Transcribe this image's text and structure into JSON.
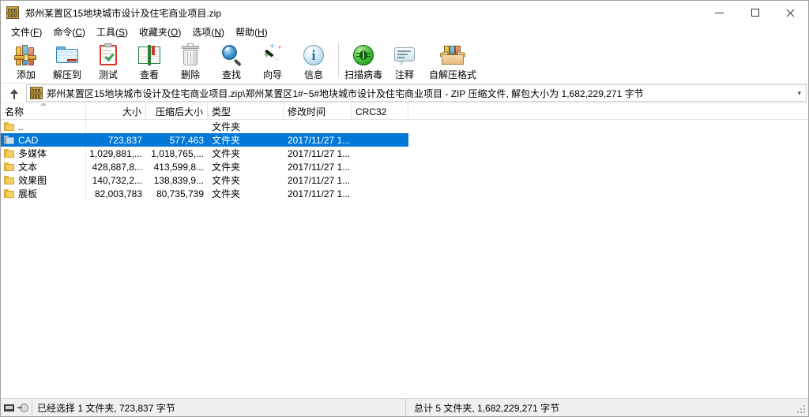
{
  "window": {
    "title": "郑州某置区15地块城市设计及住宅商业项目.zip",
    "icon": "winrar-archive-icon",
    "minimize_label": "最小化",
    "maximize_label": "最大化",
    "close_label": "关闭"
  },
  "menu": {
    "items": [
      {
        "label": "文件(F)",
        "text": "文件(",
        "accel": "F",
        "tail": ")"
      },
      {
        "label": "命令(C)",
        "text": "命令(",
        "accel": "C",
        "tail": ")"
      },
      {
        "label": "工具(S)",
        "text": "工具(",
        "accel": "S",
        "tail": ")"
      },
      {
        "label": "收藏夹(O)",
        "text": "收藏夹(",
        "accel": "O",
        "tail": ")"
      },
      {
        "label": "选项(N)",
        "text": "选项(",
        "accel": "N",
        "tail": ")"
      },
      {
        "label": "帮助(H)",
        "text": "帮助(",
        "accel": "H",
        "tail": ")"
      }
    ]
  },
  "toolbar": {
    "buttons": [
      {
        "label": "添加",
        "icon": "add-archive-icon"
      },
      {
        "label": "解压到",
        "icon": "extract-to-folder-icon"
      },
      {
        "label": "测试",
        "icon": "test-clipboard-icon"
      },
      {
        "label": "查看",
        "icon": "view-book-icon"
      },
      {
        "label": "删除",
        "icon": "delete-trash-icon"
      },
      {
        "label": "查找",
        "icon": "find-magnifier-icon"
      },
      {
        "label": "向导",
        "icon": "wizard-wand-icon"
      },
      {
        "label": "信息",
        "icon": "info-circle-icon"
      },
      {
        "label": "扫描病毒",
        "icon": "virus-scan-icon"
      },
      {
        "label": "注释",
        "icon": "comment-bubble-icon"
      },
      {
        "label": "自解压格式",
        "icon": "sfx-box-icon"
      }
    ]
  },
  "address": {
    "up_button_label": "上一层",
    "icon": "winrar-archive-icon",
    "path": "郑州某置区15地块城市设计及住宅商业项目.zip\\郑州某置区1#~5#地块城市设计及住宅商业项目 - ZIP 压缩文件, 解包大小为 1,682,229,271 字节",
    "dropdown_icon": "chevron-down-icon"
  },
  "list": {
    "columns": [
      {
        "key": "name",
        "label": "名称",
        "align": "left",
        "sorted": true
      },
      {
        "key": "size",
        "label": "大小",
        "align": "right"
      },
      {
        "key": "packed",
        "label": "压缩后大小",
        "align": "right"
      },
      {
        "key": "type",
        "label": "类型",
        "align": "left"
      },
      {
        "key": "modified",
        "label": "修改时间",
        "align": "left"
      },
      {
        "key": "crc32",
        "label": "CRC32",
        "align": "left"
      }
    ],
    "rows": [
      {
        "name": "..",
        "size": "",
        "packed": "",
        "type": "文件夹",
        "modified": "",
        "crc32": "",
        "selected": false,
        "parent": true
      },
      {
        "name": "CAD",
        "size": "723,837",
        "packed": "577,463",
        "type": "文件夹",
        "modified": "2017/11/27 1...",
        "crc32": "",
        "selected": true
      },
      {
        "name": "多媒体",
        "size": "1,029,881,...",
        "packed": "1,018,765,...",
        "type": "文件夹",
        "modified": "2017/11/27 1...",
        "crc32": "",
        "selected": false
      },
      {
        "name": "文本",
        "size": "428,887,8...",
        "packed": "413,599,8...",
        "type": "文件夹",
        "modified": "2017/11/27 1...",
        "crc32": "",
        "selected": false
      },
      {
        "name": "效果图",
        "size": "140,732,2...",
        "packed": "138,839,9...",
        "type": "文件夹",
        "modified": "2017/11/27 1...",
        "crc32": "",
        "selected": false
      },
      {
        "name": "展板",
        "size": "82,003,783",
        "packed": "80,735,739",
        "type": "文件夹",
        "modified": "2017/11/27 1...",
        "crc32": "",
        "selected": false
      }
    ]
  },
  "statusbar": {
    "selection_text": "已经选择 1 文件夹, 723,837 字节",
    "total_text": "总计 5 文件夹, 1,682,229,271 字节",
    "icons": [
      "drive-icon",
      "key-icon"
    ]
  },
  "colors": {
    "selection": "#0078d7",
    "chrome": "#ffffff",
    "statusbar": "#f0f0f0",
    "divider": "#e3e3e3"
  }
}
